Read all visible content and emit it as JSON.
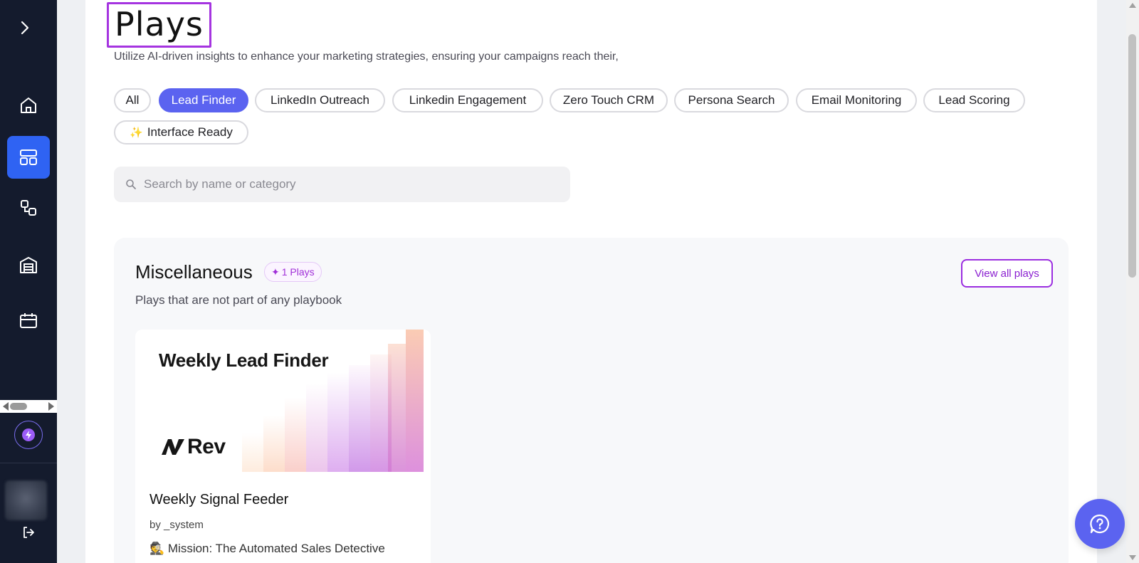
{
  "sidebar": {
    "items": [
      {
        "name": "home",
        "icon": "home-icon"
      },
      {
        "name": "plays",
        "icon": "layout-grid-icon",
        "active": true
      },
      {
        "name": "workflows",
        "icon": "flow-icon"
      },
      {
        "name": "warehouse",
        "icon": "warehouse-icon"
      },
      {
        "name": "calendar",
        "icon": "calendar-icon"
      }
    ]
  },
  "page": {
    "title": "Plays",
    "subtitle": "Utilize AI-driven insights to enhance your marketing strategies, ensuring your campaigns reach their,"
  },
  "filters": {
    "chips": [
      "All",
      "Lead Finder",
      "LinkedIn Outreach",
      "Linkedin Engagement",
      "Zero Touch CRM",
      "Persona Search",
      "Email Monitoring",
      "Lead Scoring",
      "Interface Ready"
    ],
    "active": "Lead Finder"
  },
  "search": {
    "placeholder": "Search by name or category",
    "value": ""
  },
  "section": {
    "title": "Miscellaneous",
    "badge": "1 Plays",
    "description": "Plays that are not part of any playbook",
    "view_all_label": "View all plays"
  },
  "card": {
    "hero_title": "Weekly Lead Finder",
    "hero_logo_text": "Rev",
    "title": "Weekly Signal Feeder",
    "by": "by _system",
    "mission": "🕵️ Mission: The Automated Sales Detective"
  },
  "colors": {
    "sidebar_bg": "#141b2d",
    "accent": "#5b63f0",
    "active_nav": "#2f63f3",
    "highlight_border": "#a534e0"
  }
}
